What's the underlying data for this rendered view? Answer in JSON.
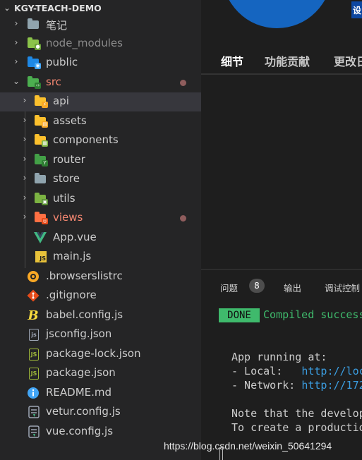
{
  "explorer": {
    "root_label": "KGY-TEACH-DEMO",
    "items": [
      {
        "label": "笔记",
        "type": "folder"
      },
      {
        "label": "node_modules",
        "type": "folder"
      },
      {
        "label": "public",
        "type": "folder"
      },
      {
        "label": "src",
        "type": "folder",
        "expanded": true
      },
      {
        "label": "api",
        "type": "folder",
        "selected": true
      },
      {
        "label": "assets",
        "type": "folder"
      },
      {
        "label": "components",
        "type": "folder"
      },
      {
        "label": "router",
        "type": "folder"
      },
      {
        "label": "store",
        "type": "folder"
      },
      {
        "label": "utils",
        "type": "folder"
      },
      {
        "label": "views",
        "type": "folder",
        "modified": true
      },
      {
        "label": "App.vue",
        "type": "file"
      },
      {
        "label": "main.js",
        "type": "file"
      },
      {
        "label": ".browserslistrc",
        "type": "file"
      },
      {
        "label": ".gitignore",
        "type": "file"
      },
      {
        "label": "babel.config.js",
        "type": "file"
      },
      {
        "label": "jsconfig.json",
        "type": "file"
      },
      {
        "label": "package-lock.json",
        "type": "file"
      },
      {
        "label": "package.json",
        "type": "file"
      },
      {
        "label": "README.md",
        "type": "file"
      },
      {
        "label": "vetur.config.js",
        "type": "file"
      },
      {
        "label": "vue.config.js",
        "type": "file"
      }
    ]
  },
  "right_panel": {
    "sticker_text": "设",
    "tabs": [
      "细节",
      "功能贡献",
      "更改日"
    ]
  },
  "bottom_panel": {
    "tabs": [
      "问题",
      "输出",
      "调试控制"
    ],
    "problems_count": "8",
    "done_label": "DONE",
    "compiled_text": "Compiled successfully",
    "app_running": "App running at:",
    "local_label": "- Local:   ",
    "local_url": "http://localhost",
    "network_label": "- Network: ",
    "network_url": "http://172",
    "note_line": "Note that the development build",
    "create_line": "To create a production build"
  },
  "watermark": "https://blog.csdn.net/weixin_50641294",
  "colors": {
    "sidebar_bg": "#252526",
    "editor_bg": "#1e1e1e",
    "selected_row": "#37373d",
    "modified_red": "#f48771",
    "ignored_grey": "#8b8b8b",
    "done_green": "#3fba6c",
    "link_blue": "#3b9ee2"
  }
}
